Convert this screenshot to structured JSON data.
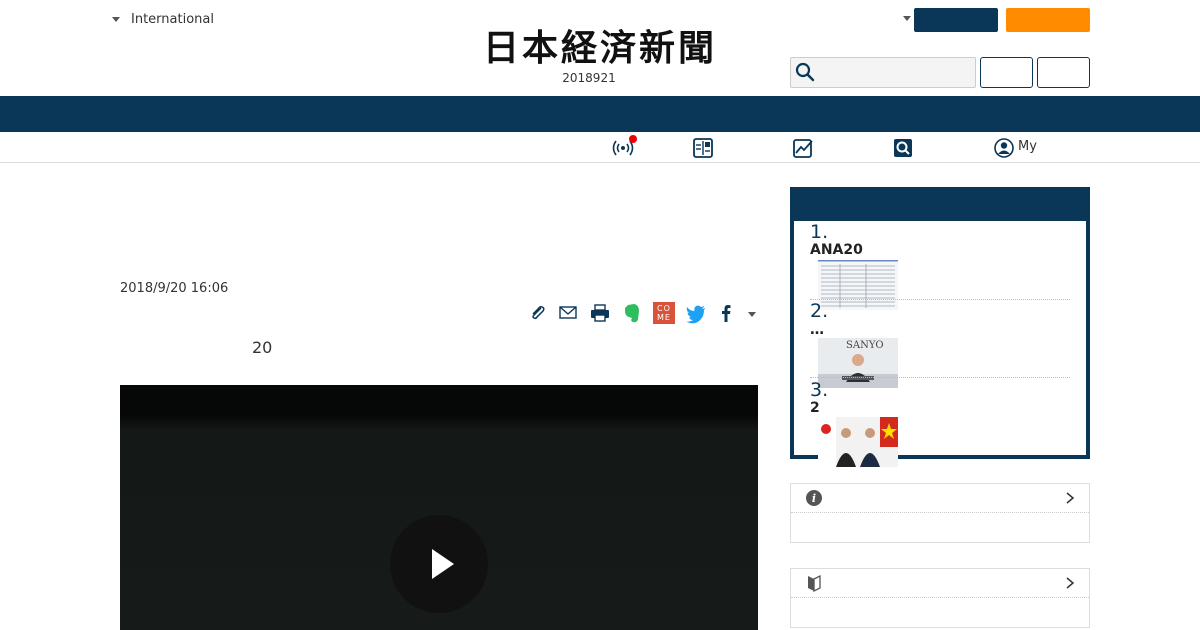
{
  "header": {
    "edition_label": "International",
    "logo_text": "日本経済新聞",
    "date_text": "2018921",
    "search": {
      "placeholder": "",
      "icon": "search-icon"
    },
    "buttons": {
      "navy_label": "",
      "orange_label": "",
      "outline1_label": "",
      "outline2_label": ""
    }
  },
  "subnav": {
    "items": [
      {
        "icon": "broadcast-icon",
        "label": ""
      },
      {
        "icon": "newspaper-icon",
        "label": ""
      },
      {
        "icon": "chart-icon",
        "label": ""
      },
      {
        "icon": "search-icon",
        "label": ""
      },
      {
        "icon": "user-icon",
        "label": "My"
      }
    ]
  },
  "article": {
    "date": "2018/9/20 16:06",
    "lead": "20",
    "share_icons": [
      "clip-icon",
      "mail-icon",
      "print-icon",
      "evernote-icon",
      "come-icon",
      "twitter-icon",
      "facebook-icon",
      "more-icon"
    ],
    "come_label": "CO ME",
    "video": {
      "play_icon": "play-icon"
    }
  },
  "ranking": {
    "items": [
      {
        "number": "1.",
        "title": "ANA20"
      },
      {
        "number": "2.",
        "title": "…"
      },
      {
        "number": "3.",
        "title": "2"
      }
    ],
    "thumb2_sign": "SANYO"
  },
  "panels": [
    {
      "icon": "info-icon",
      "label": ""
    },
    {
      "icon": "beginner-icon",
      "label": ""
    }
  ],
  "colors": {
    "navy": "#0a3758",
    "orange": "#ff8c00",
    "alert": "#ee0000"
  }
}
